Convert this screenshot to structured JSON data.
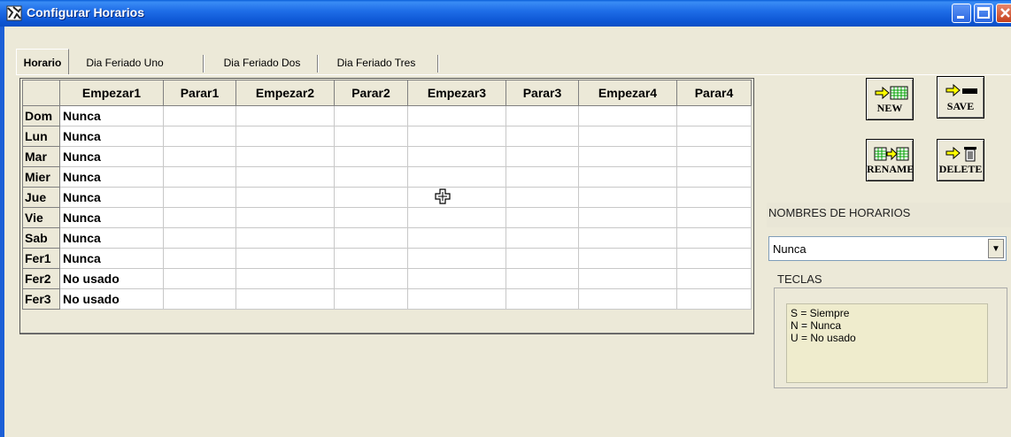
{
  "window": {
    "title": "Configurar Horarios"
  },
  "tabs": [
    {
      "label": "Horario",
      "active": true
    },
    {
      "label": "Dia Feriado Uno",
      "active": false
    },
    {
      "label": "Dia Feriado Dos",
      "active": false
    },
    {
      "label": "Dia Feriado Tres",
      "active": false
    }
  ],
  "grid": {
    "columns": [
      "",
      "Empezar1",
      "Parar1",
      "Empezar2",
      "Parar2",
      "Empezar3",
      "Parar3",
      "Empezar4",
      "Parar4"
    ],
    "rows": [
      {
        "day": "Dom",
        "empezar1": "Nunca"
      },
      {
        "day": "Lun",
        "empezar1": "Nunca"
      },
      {
        "day": "Mar",
        "empezar1": "Nunca"
      },
      {
        "day": "Mier",
        "empezar1": "Nunca"
      },
      {
        "day": "Jue",
        "empezar1": "Nunca"
      },
      {
        "day": "Vie",
        "empezar1": "Nunca"
      },
      {
        "day": "Sab",
        "empezar1": "Nunca"
      },
      {
        "day": "Fer1",
        "empezar1": "Nunca"
      },
      {
        "day": "Fer2",
        "empezar1": "No usado"
      },
      {
        "day": "Fer3",
        "empezar1": "No usado"
      }
    ]
  },
  "buttons": {
    "new": "NEW",
    "save": "SAVE",
    "rename": "RENAME",
    "delete": "DELETE"
  },
  "schedule_names": {
    "label": "NOMBRES DE HORARIOS",
    "selected": "Nunca"
  },
  "teclas": {
    "label": "TECLAS",
    "lines": [
      "S = Siempre",
      "N = Nunca",
      "U = No usado"
    ]
  },
  "colors": {
    "titlebar": "#0d56d4",
    "face": "#ece9d8",
    "accent_arrow": "#ffff00",
    "grid_icon": "#00a000"
  }
}
